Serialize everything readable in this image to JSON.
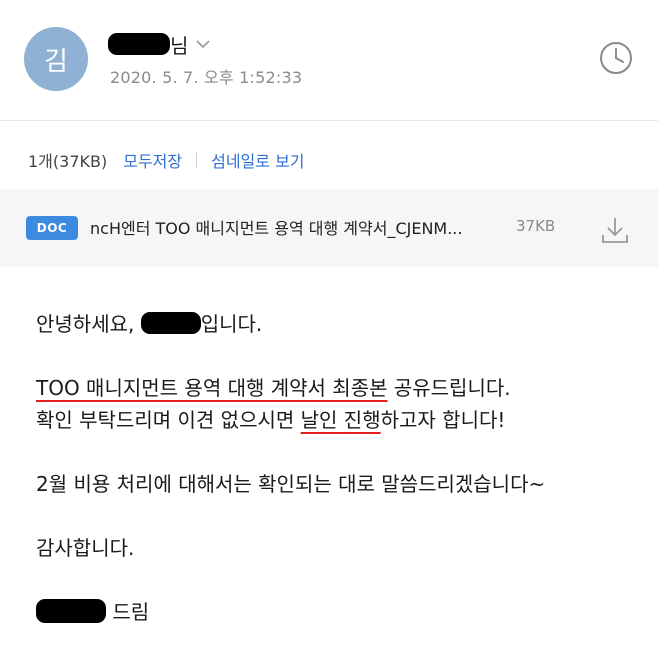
{
  "header": {
    "avatar_initial": "김",
    "sender_suffix": "님",
    "datetime": "2020. 5. 7. 오후 1:52:33"
  },
  "attachments": {
    "count_text": "1개(37KB)",
    "save_all_label": "모두저장",
    "thumbnail_view_label": "섬네일로 보기",
    "file": {
      "type_badge": "DOC",
      "name": "ncH엔터 TOO 매니지먼트 용역 대행 계약서_CJENM...",
      "size": "37KB"
    }
  },
  "message": {
    "greeting_prefix": "안녕하세요, ",
    "greeting_suffix": "입니다.",
    "line2_underlined": "TOO 매니지먼트 용역 대행 계약서 최종본",
    "line2_rest": " 공유드립니다.",
    "line3_a": "확인 부탁드리며 이견 없으시면 ",
    "line3_underlined": "날인 진행",
    "line3_b": "하고자 합니다!",
    "line4": "2월 비용 처리에 대해서는 확인되는 대로 말씀드리겠습니다~",
    "thanks": "감사합니다.",
    "signoff_suffix": " 드림"
  },
  "colors": {
    "link": "#2f6fd0",
    "avatar_bg": "#8fb1d3",
    "doc_badge": "#3d8be0",
    "underline_red": "#e02020"
  },
  "icons": [
    "chevron-down-icon",
    "clock-icon",
    "download-icon"
  ]
}
